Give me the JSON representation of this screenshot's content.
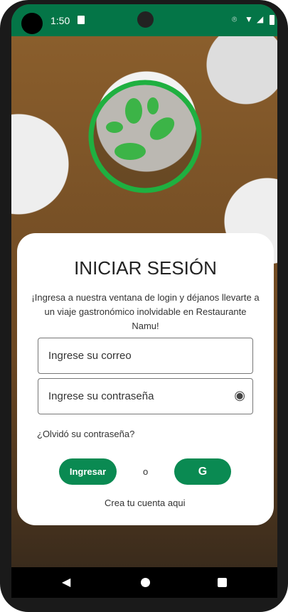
{
  "status": {
    "time": "1:50"
  },
  "login": {
    "title": "INICIAR SESIÓN",
    "description": "¡Ingresa a nuestra ventana de login y déjanos llevarte a un viaje gastronómico inolvidable en Restaurante Namu!",
    "email_placeholder": "Ingrese su correo",
    "password_placeholder": "Ingrese su contraseña",
    "forgot": "¿Olvidó su contraseña?",
    "submit": "Ingresar",
    "or": "o",
    "google": "G",
    "register": "Crea tu cuenta aqui"
  }
}
